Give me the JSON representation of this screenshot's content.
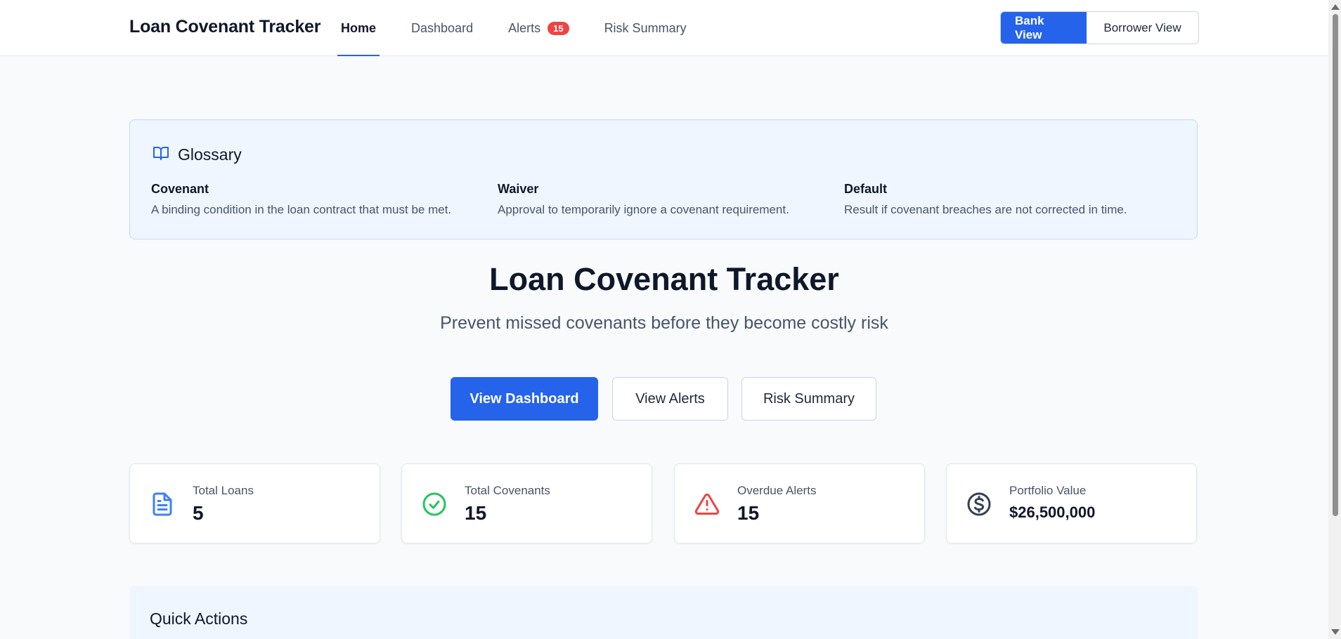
{
  "header": {
    "brand": "Loan Covenant Tracker",
    "nav": [
      {
        "label": "Home",
        "active": true
      },
      {
        "label": "Dashboard",
        "active": false
      },
      {
        "label": "Alerts",
        "badge": "15",
        "active": false
      },
      {
        "label": "Risk Summary",
        "active": false
      }
    ],
    "view_toggle": {
      "bank": "Bank View",
      "borrower": "Borrower View",
      "selected": "Bank View"
    }
  },
  "glossary": {
    "title": "Glossary",
    "icon": "book-open-icon",
    "terms": [
      {
        "term": "Covenant",
        "definition": "A binding condition in the loan contract that must be met."
      },
      {
        "term": "Waiver",
        "definition": "Approval to temporarily ignore a covenant requirement."
      },
      {
        "term": "Default",
        "definition": "Result if covenant breaches are not corrected in time."
      }
    ]
  },
  "hero": {
    "title": "Loan Covenant Tracker",
    "subtitle": "Prevent missed covenants before they become costly risk",
    "buttons": {
      "dashboard": "View Dashboard",
      "alerts": "View Alerts",
      "risk": "Risk Summary"
    }
  },
  "stats": [
    {
      "label": "Total Loans",
      "value": "5",
      "icon": "file-text-icon",
      "color": "#3b82f6"
    },
    {
      "label": "Total Covenants",
      "value": "15",
      "icon": "check-circle-icon",
      "color": "#22c55e"
    },
    {
      "label": "Overdue Alerts",
      "value": "15",
      "icon": "alert-triangle-icon",
      "color": "#ef4444"
    },
    {
      "label": "Portfolio Value",
      "value": "$26,500,000",
      "icon": "dollar-circle-icon",
      "color": "#334155"
    }
  ],
  "quick_actions": {
    "title": "Quick Actions"
  },
  "colors": {
    "accent": "#2563eb",
    "danger": "#ef4444",
    "success": "#22c55e",
    "background": "#f8fafc"
  }
}
